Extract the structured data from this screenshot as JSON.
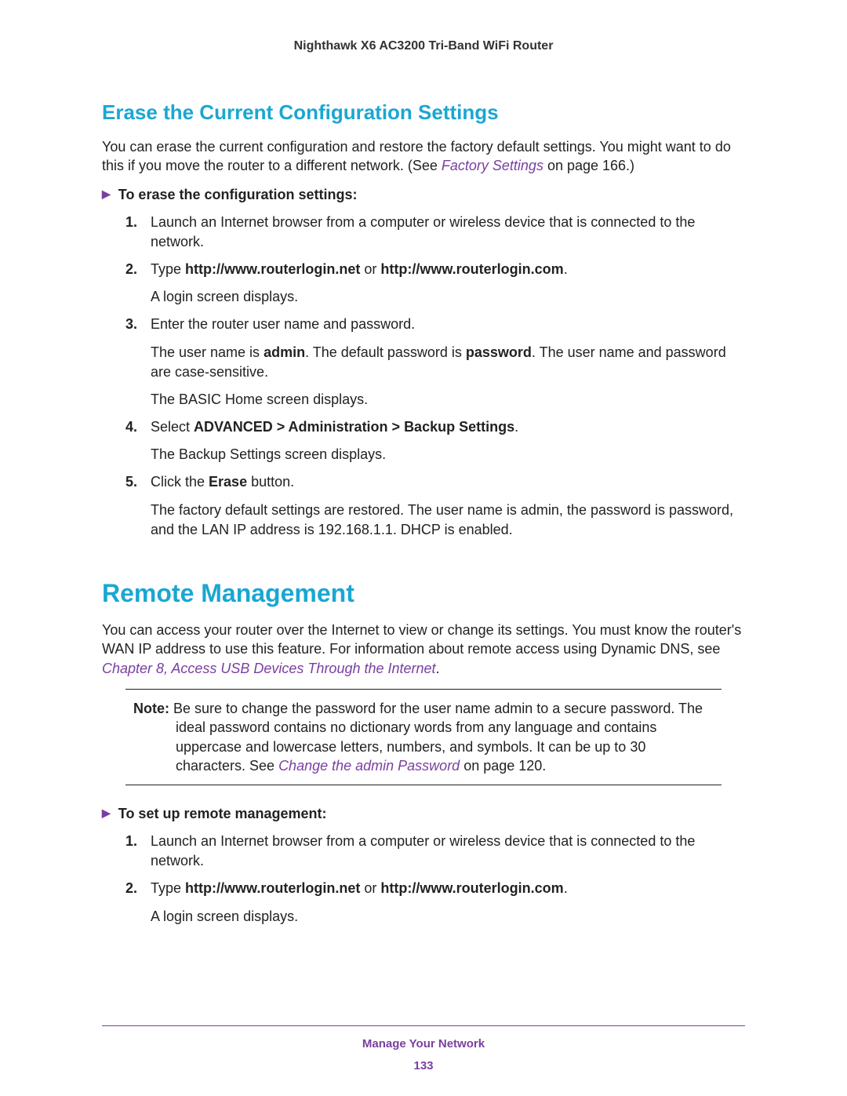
{
  "doc_title": "Nighthawk X6 AC3200 Tri-Band WiFi Router",
  "section1_heading": "Erase the Current Configuration Settings",
  "section1_intro_a": "You can erase the current configuration and restore the factory default settings. You might want to do this if you move the router to a different network. (See ",
  "section1_xref": "Factory Settings",
  "section1_intro_b": " on page 166.)",
  "proc1_head": "To erase the configuration settings:",
  "proc1": {
    "s1": "Launch an Internet browser from a computer or wireless device that is connected to the network.",
    "s2_a": "Type ",
    "s2_url1": "http://www.routerlogin.net",
    "s2_mid": " or ",
    "s2_url2": "http://www.routerlogin.com",
    "s2_end": ".",
    "s2_p2": "A login screen displays.",
    "s3_a": "Enter the router user name and password.",
    "s3_p2_a": "The user name is ",
    "s3_admin": "admin",
    "s3_p2_b": ". The default password is ",
    "s3_pwd": "password",
    "s3_p2_c": ". The user name and password are case-sensitive.",
    "s3_p3": "The BASIC Home screen displays.",
    "s4_a": "Select ",
    "s4_path": "ADVANCED > Administration > Backup Settings",
    "s4_end": ".",
    "s4_p2": "The Backup Settings screen displays.",
    "s5_a": "Click the ",
    "s5_btn": "Erase",
    "s5_b": " button.",
    "s5_p2": "The factory default settings are restored. The user name is admin, the password is password, and the LAN IP address is 192.168.1.1. DHCP is enabled."
  },
  "section2_heading": "Remote Management",
  "section2_intro_a": "You can access your router over the Internet to view or change its settings. You must know the router's WAN IP address to use this feature. For information about remote access using Dynamic DNS, see ",
  "section2_xref": "Chapter 8, Access USB Devices Through the Internet",
  "section2_intro_b": ".",
  "note_label": "Note:",
  "note_body_a": "Be sure to change the password for the user name admin to a secure password. The ideal password contains no dictionary words from any language and contains uppercase and lowercase letters, numbers, and symbols. It can be up to 30 characters. See ",
  "note_xref": "Change the admin Password",
  "note_body_b": " on page 120.",
  "proc2_head": "To set up remote management:",
  "proc2": {
    "s1": "Launch an Internet browser from a computer or wireless device that is connected to the network.",
    "s2_a": "Type ",
    "s2_url1": "http://www.routerlogin.net",
    "s2_mid": " or ",
    "s2_url2": "http://www.routerlogin.com",
    "s2_end": ".",
    "s2_p2": "A login screen displays."
  },
  "footer_chapter": "Manage Your Network",
  "footer_page": "133"
}
